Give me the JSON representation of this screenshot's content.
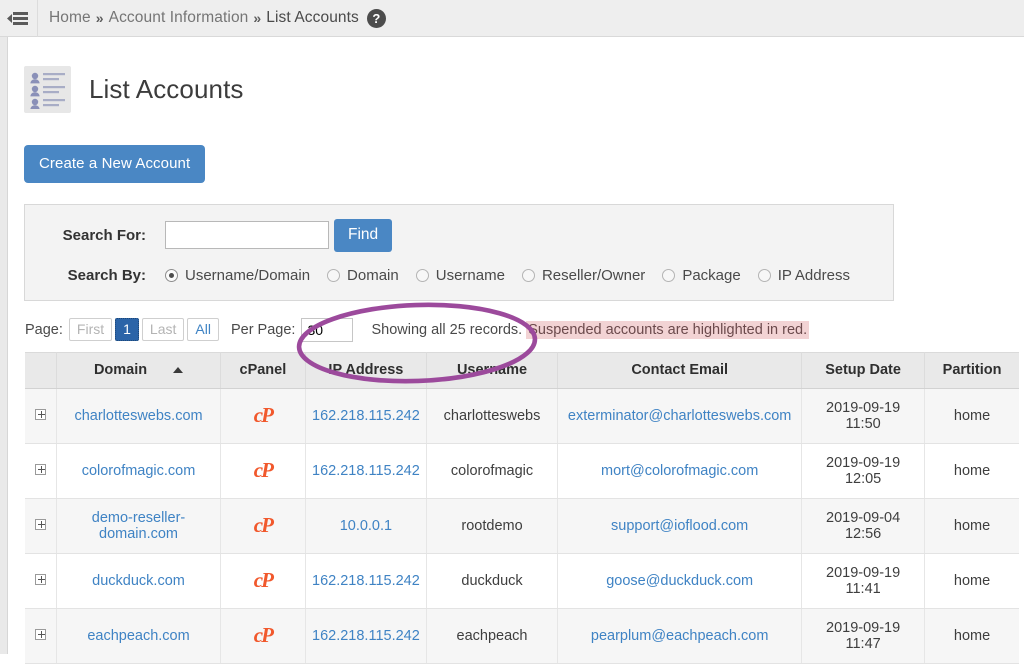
{
  "breadcrumb": {
    "menu_icon": "hamburger-menu-icon",
    "items": [
      {
        "label": "Home",
        "current": false
      },
      {
        "label": "Account Information",
        "current": false
      },
      {
        "label": "List Accounts",
        "current": true
      }
    ],
    "separator": "»",
    "help_icon": "?"
  },
  "page": {
    "title": "List Accounts",
    "icon": "list-accounts-icon"
  },
  "toolbar": {
    "create_account_label": "Create a New Account"
  },
  "search": {
    "search_for_label": "Search For:",
    "search_for_value": "",
    "search_for_placeholder": "",
    "find_label": "Find",
    "search_by_label": "Search By:",
    "options": [
      {
        "label": "Username/Domain",
        "selected": true
      },
      {
        "label": "Domain",
        "selected": false
      },
      {
        "label": "Username",
        "selected": false
      },
      {
        "label": "Reseller/Owner",
        "selected": false
      },
      {
        "label": "Package",
        "selected": false
      },
      {
        "label": "IP Address",
        "selected": false
      }
    ]
  },
  "pager": {
    "page_label": "Page:",
    "first_label": "First",
    "current_page": "1",
    "last_label": "Last",
    "all_label": "All",
    "per_page_label": "Per Page:",
    "per_page_value": "30",
    "showing_text": "Showing all 25 records.",
    "suspended_note": "Suspended accounts are highlighted in red."
  },
  "table": {
    "columns": [
      {
        "key": "expander",
        "label": ""
      },
      {
        "key": "domain",
        "label": "Domain",
        "sorted": "asc"
      },
      {
        "key": "cpanel",
        "label": "cPanel"
      },
      {
        "key": "ip",
        "label": "IP Address"
      },
      {
        "key": "username",
        "label": "Username"
      },
      {
        "key": "email",
        "label": "Contact Email"
      },
      {
        "key": "setup_date",
        "label": "Setup Date"
      },
      {
        "key": "partition",
        "label": "Partition"
      }
    ],
    "cpanel_icon": "cP",
    "rows": [
      {
        "domain": "charlotteswebs.com",
        "ip": "162.218.115.242",
        "username": "charlotteswebs",
        "email": "exterminator@charlotteswebs.com",
        "setup_date": "2019-09-19 11:50",
        "partition": "home"
      },
      {
        "domain": "colorofmagic.com",
        "ip": "162.218.115.242",
        "username": "colorofmagic",
        "email": "mort@colorofmagic.com",
        "setup_date": "2019-09-19 12:05",
        "partition": "home"
      },
      {
        "domain": "demo-reseller-domain.com",
        "ip": "10.0.0.1",
        "username": "rootdemo",
        "email": "support@ioflood.com",
        "setup_date": "2019-09-04 12:56",
        "partition": "home"
      },
      {
        "domain": "duckduck.com",
        "ip": "162.218.115.242",
        "username": "duckduck",
        "email": "goose@duckduck.com",
        "setup_date": "2019-09-19 11:41",
        "partition": "home"
      },
      {
        "domain": "eachpeach.com",
        "ip": "162.218.115.242",
        "username": "eachpeach",
        "email": "pearplum@eachpeach.com",
        "setup_date": "2019-09-19 11:47",
        "partition": "home"
      }
    ]
  },
  "annotation": {
    "shape": "ellipse",
    "color": "#9c4a9c"
  },
  "colors": {
    "primary_button": "#4a87c4",
    "link": "#3f83c4",
    "cpanel_orange": "#f1582c",
    "suspended_highlight": "#f2d3d4",
    "annotation_purple": "#9c4a9c"
  }
}
